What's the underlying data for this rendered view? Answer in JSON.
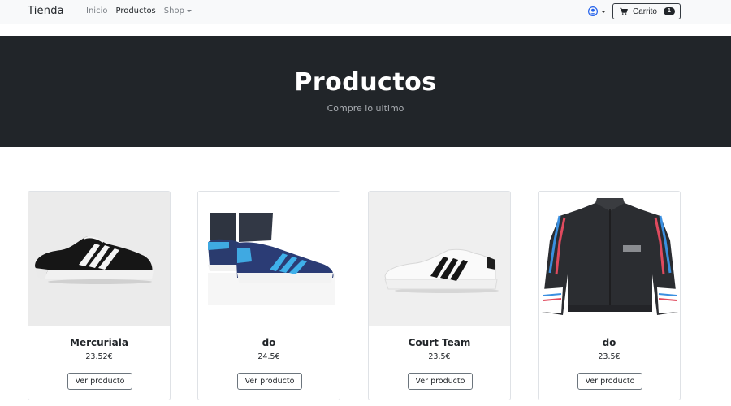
{
  "navbar": {
    "brand": "Tienda",
    "links": [
      {
        "label": "Inicio"
      },
      {
        "label": "Productos"
      },
      {
        "label": "Shop"
      }
    ],
    "cart": {
      "label": "Carrito",
      "count": "1"
    }
  },
  "hero": {
    "title": "Productos",
    "subtitle": "Compre lo ultimo"
  },
  "products": [
    {
      "name": "Mercuriala",
      "price": "23.52€",
      "button": "Ver producto"
    },
    {
      "name": "do",
      "price": "24.5€",
      "button": "Ver producto"
    },
    {
      "name": "Court Team",
      "price": "23.5€",
      "button": "Ver producto"
    },
    {
      "name": "do",
      "price": "23.5€",
      "button": "Ver producto"
    }
  ]
}
